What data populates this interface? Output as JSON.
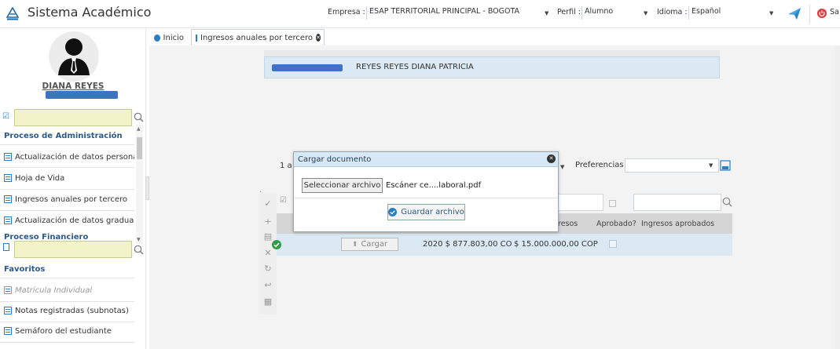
{
  "app": {
    "title": "Sistema Académico"
  },
  "header": {
    "empresa_label": "Empresa :",
    "empresa_value": "ESAP TERRITORIAL PRINCIPAL - BOGOTA",
    "perfil_label": "Perfil :",
    "perfil_value": "Alumno",
    "idioma_label": "Idioma :",
    "idioma_value": "Español",
    "salir_label": "Sa"
  },
  "user": {
    "name": "DIANA REYES"
  },
  "sidebar": {
    "section_admin": "Proceso de Administración",
    "admin_items": [
      "Actualización de datos personale",
      "Hoja de Vida",
      "Ingresos anuales por tercero",
      "Actualización de datos graduado:"
    ],
    "section_fin": "Proceso Financiero",
    "favorites_title": "Favoritos",
    "fav_items": [
      "Matrícula Individual",
      "Notas registradas (subnotas)",
      "Semáforo del estudiante"
    ]
  },
  "tabs": [
    {
      "label": "Inicio"
    },
    {
      "label": "Ingresos anuales por tercero"
    }
  ],
  "record": {
    "name": "REYES REYES DIANA PATRICIA"
  },
  "grid": {
    "pager_text": "1 a",
    "preferences_label": "Preferencias :",
    "headers": [
      "resos",
      "Aprobado?",
      "Ingresos aprobados"
    ],
    "row": {
      "load_button": "Cargar",
      "year_amount": "2020 $ 877.803,00 CO",
      "income": "$ 15.000.000,00 COP"
    }
  },
  "modal": {
    "title": "Cargar documento",
    "file_button": "Seleccionar archivo",
    "file_name": "Escáner ce....laboral.pdf",
    "save_button": "Guardar archivo"
  },
  "colors": {
    "accent": "#2a7fc4",
    "header_bg": "#d7e8f6",
    "highlight": "#dbe9f4",
    "redacted": "#3d73c1"
  }
}
